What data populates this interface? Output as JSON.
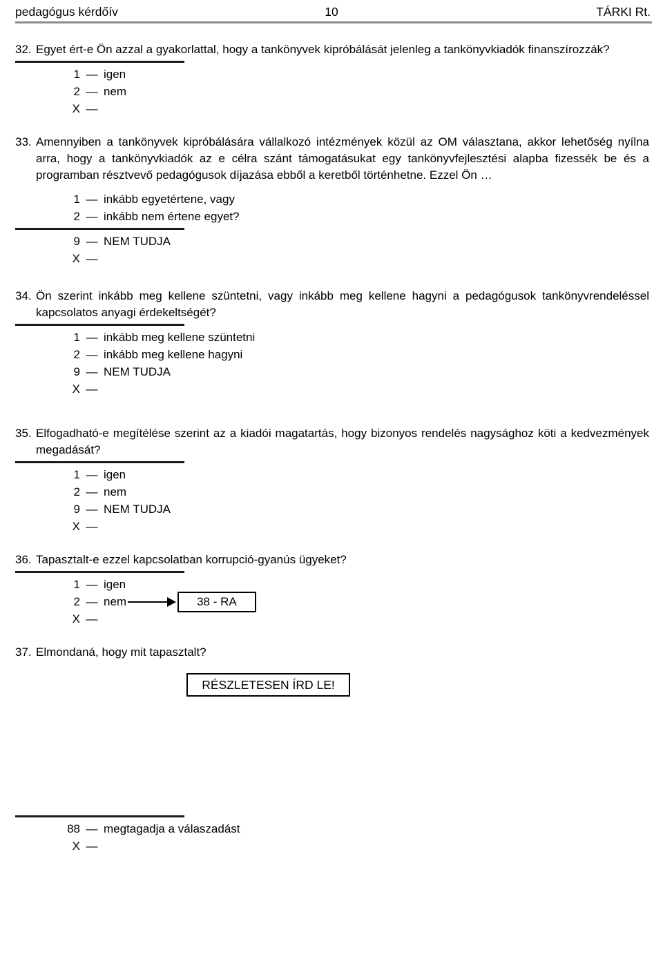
{
  "header": {
    "left": "pedagógus kérdőív",
    "page_number": "10",
    "right": "TÁRKI Rt."
  },
  "questions": [
    {
      "number": "32.",
      "text": "Egyet ért-e Ön azzal a gyakorlattal, hogy a tankönyvek kipróbálását jelenleg a tankönyvkiadók finanszírozzák?",
      "options": [
        {
          "code": "1",
          "dash": "—",
          "label": "igen"
        },
        {
          "code": "2",
          "dash": "—",
          "label": "nem"
        },
        {
          "code": "X",
          "dash": "—",
          "label": ""
        }
      ]
    },
    {
      "number": "33.",
      "text": "Amennyiben a tankönyvek kipróbálására vállalkozó intézmények közül az OM választana, akkor lehetőség nyílna arra, hogy a tankönyvkiadók az e célra szánt támogatásukat egy tankönyvfejlesztési alapba fizessék be és a programban résztvevő  pedagógusok díjazása ebből a keretből történhetne. Ezzel Ön …",
      "options_before_rule": [
        {
          "code": "1",
          "dash": "—",
          "label": "inkább egyetértene, vagy"
        },
        {
          "code": "2",
          "dash": "—",
          "label": "inkább nem értene egyet?"
        }
      ],
      "options_after_rule": [
        {
          "code": "9",
          "dash": "—",
          "label": "NEM TUDJA"
        },
        {
          "code": "X",
          "dash": "—",
          "label": ""
        }
      ]
    },
    {
      "number": "34.",
      "text": "Ön szerint inkább meg kellene szüntetni, vagy inkább meg kellene hagyni a pedagógusok tankönyvrendeléssel kapcsolatos anyagi érdekeltségét?",
      "options": [
        {
          "code": "1",
          "dash": "—",
          "label": "inkább meg kellene szüntetni"
        },
        {
          "code": "2",
          "dash": "—",
          "label": "inkább meg kellene hagyni"
        },
        {
          "code": "9",
          "dash": "—",
          "label": "NEM TUDJA"
        },
        {
          "code": "X",
          "dash": "—",
          "label": ""
        }
      ]
    },
    {
      "number": "35.",
      "text": "Elfogadható-e megítélése szerint az a kiadói magatartás, hogy bizonyos rendelés nagysághoz köti a kedvezmények megadását?",
      "options": [
        {
          "code": "1",
          "dash": "—",
          "label": "igen"
        },
        {
          "code": "2",
          "dash": "—",
          "label": "nem"
        },
        {
          "code": "9",
          "dash": "—",
          "label": "NEM TUDJA"
        },
        {
          "code": "X",
          "dash": "—",
          "label": ""
        }
      ]
    },
    {
      "number": "36.",
      "text": "Tapasztalt-e ezzel kapcsolatban korrupció-gyanús ügyeket?",
      "options": [
        {
          "code": "1",
          "dash": "—",
          "label": "igen"
        },
        {
          "code": "2",
          "dash": "—",
          "label": "nem",
          "goto": "38 - RA"
        },
        {
          "code": "X",
          "dash": "—",
          "label": ""
        }
      ]
    },
    {
      "number": "37.",
      "text": "Elmondaná, hogy mit tapasztalt?",
      "instruction_box": "RÉSZLETESEN ÍRD LE!"
    }
  ],
  "footer_options": [
    {
      "code": "88",
      "dash": "—",
      "label": "megtagadja a válaszadást"
    },
    {
      "code": "X",
      "dash": "—",
      "label": ""
    }
  ]
}
